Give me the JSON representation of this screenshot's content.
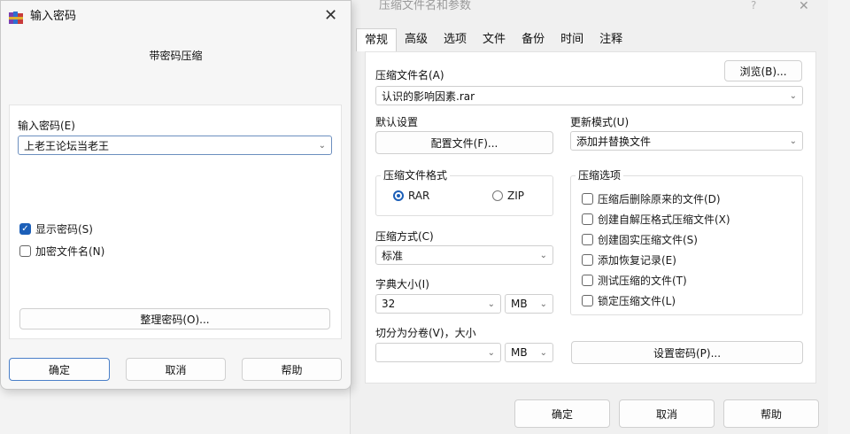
{
  "back_dialog": {
    "title": "压缩文件名和参数",
    "help_glyph": "?",
    "close_glyph": "✕",
    "tabs": [
      {
        "label": "常规"
      },
      {
        "label": "高级"
      },
      {
        "label": "选项"
      },
      {
        "label": "文件"
      },
      {
        "label": "备份"
      },
      {
        "label": "时间"
      },
      {
        "label": "注释"
      }
    ],
    "archive_name_label": "压缩文件名(A)",
    "browse_button": "浏览(B)...",
    "archive_name_value": "认识的影响因素.rar",
    "default_settings_label": "默认设置",
    "profiles_button": "配置文件(F)...",
    "update_mode_label": "更新模式(U)",
    "update_mode_value": "添加并替换文件",
    "format_group_label": "压缩文件格式",
    "format_rar": "RAR",
    "format_zip": "ZIP",
    "method_label": "压缩方式(C)",
    "method_value": "标准",
    "dict_label": "字典大小(I)",
    "dict_value": "32",
    "dict_unit": "MB",
    "split_label": "切分为分卷(V)，大小",
    "split_value": "",
    "split_unit": "MB",
    "options_group_label": "压缩选项",
    "options": [
      {
        "label": "压缩后删除原来的文件(D)",
        "checked": false
      },
      {
        "label": "创建自解压格式压缩文件(X)",
        "checked": false
      },
      {
        "label": "创建固实压缩文件(S)",
        "checked": false
      },
      {
        "label": "添加恢复记录(E)",
        "checked": false
      },
      {
        "label": "测试压缩的文件(T)",
        "checked": false
      },
      {
        "label": "锁定压缩文件(L)",
        "checked": false
      }
    ],
    "set_password_button": "设置密码(P)...",
    "ok_button": "确定",
    "cancel_button": "取消",
    "help_button": "帮助"
  },
  "password_dialog": {
    "title": "输入密码",
    "close_glyph": "✕",
    "subtitle": "带密码压缩",
    "password_label": "输入密码(E)",
    "password_value": "上老王论坛当老王",
    "show_password_label": "显示密码(S)",
    "show_password_checked": true,
    "encrypt_names_label": "加密文件名(N)",
    "encrypt_names_checked": false,
    "organize_button": "整理密码(O)...",
    "ok_button": "确定",
    "cancel_button": "取消",
    "help_button": "帮助"
  },
  "icons": {
    "app": "winrar-books-icon",
    "chevron": "chevron-down-icon",
    "check": "checkmark-icon"
  },
  "colors": {
    "accent": "#1c5fb8",
    "focus_border": "#6c8fbf"
  }
}
